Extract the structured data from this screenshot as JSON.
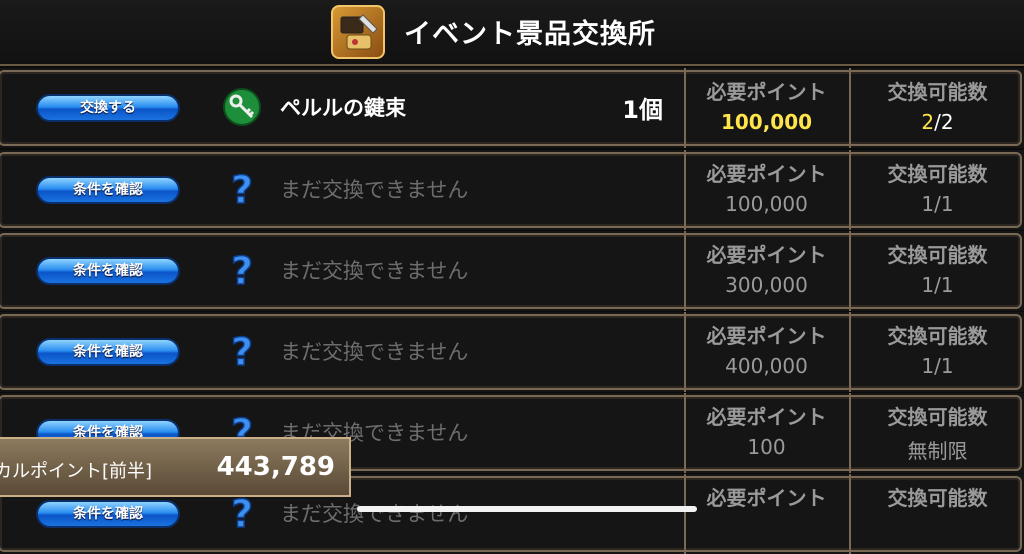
{
  "header": {
    "title": "イベント景品交換所",
    "icon": "event-shop-icon"
  },
  "rows": [
    {
      "button": "交換する",
      "icon": "key-bundle-icon",
      "name": "ペルルの鍵束",
      "qty": "1個",
      "points_label": "必要ポイント",
      "points": "100,000",
      "count_label": "交換可能数",
      "count_a": "2",
      "count_b": "/2"
    },
    {
      "button": "条件を確認",
      "icon": "question-icon",
      "name": "まだ交換できません",
      "qty": "",
      "points_label": "必要ポイント",
      "points": "100,000",
      "count_label": "交換可能数",
      "count": "1/1"
    },
    {
      "button": "条件を確認",
      "icon": "question-icon",
      "name": "まだ交換できません",
      "qty": "",
      "points_label": "必要ポイント",
      "points": "300,000",
      "count_label": "交換可能数",
      "count": "1/1"
    },
    {
      "button": "条件を確認",
      "icon": "question-icon",
      "name": "まだ交換できません",
      "qty": "",
      "points_label": "必要ポイント",
      "points": "400,000",
      "count_label": "交換可能数",
      "count": "1/1"
    },
    {
      "button": "条件を確認",
      "icon": "question-icon",
      "name": "まだ交換できません",
      "qty": "",
      "points_label": "必要ポイント",
      "points": "100",
      "count_label": "交換可能数",
      "count": "無制限"
    },
    {
      "button": "条件を確認",
      "icon": "question-icon",
      "name": "まだ交換できません",
      "qty": "",
      "points_label": "必要ポイント",
      "points": "",
      "count_label": "交換可能数",
      "count": ""
    }
  ],
  "points_overlay": {
    "label": "カルポイント[前半]",
    "value": "443,789"
  },
  "colors": {
    "accent_yellow": "#ffe44a",
    "button_blue": "#1a73e0",
    "frame": "#7a6a55"
  }
}
